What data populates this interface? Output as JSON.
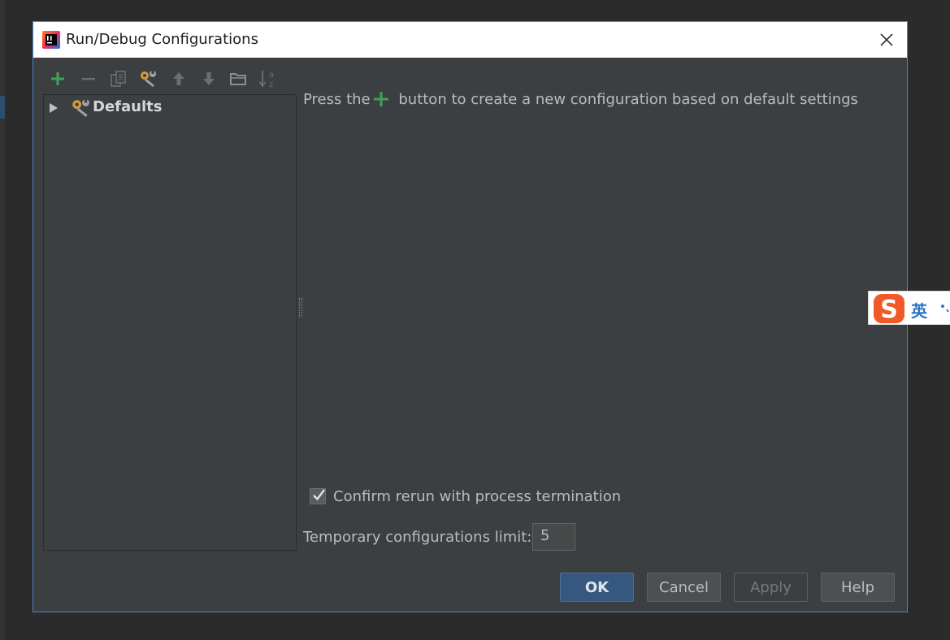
{
  "dialog": {
    "title": "Run/Debug Configurations"
  },
  "toolbar": {
    "buttons": [
      {
        "name": "add",
        "icon": "plus-icon",
        "color": "#3fa05b"
      },
      {
        "name": "remove",
        "icon": "minus-icon"
      },
      {
        "name": "copy",
        "icon": "copy-icon"
      },
      {
        "name": "edit-defaults",
        "icon": "wrench-icon"
      },
      {
        "name": "move-up",
        "icon": "arrow-up-icon"
      },
      {
        "name": "move-down",
        "icon": "arrow-down-icon"
      },
      {
        "name": "folder",
        "icon": "folder-icon"
      },
      {
        "name": "sort",
        "icon": "sort-alpha-icon"
      }
    ]
  },
  "tree": {
    "items": [
      {
        "label": "Defaults",
        "icon": "wrench-icon",
        "expanded": false
      }
    ]
  },
  "main": {
    "hint_before": "Press the",
    "hint_after": " button to create a new configuration based on default settings",
    "confirm_label": "Confirm rerun with process termination",
    "confirm_checked": true,
    "limit_label": "Temporary configurations limit:",
    "limit_value": "5"
  },
  "buttons": {
    "ok": "OK",
    "cancel": "Cancel",
    "apply": "Apply",
    "help": "Help"
  },
  "ime": {
    "lang": "英",
    "logo_icon": "sogou-s-icon",
    "accent": "#f05a28"
  }
}
